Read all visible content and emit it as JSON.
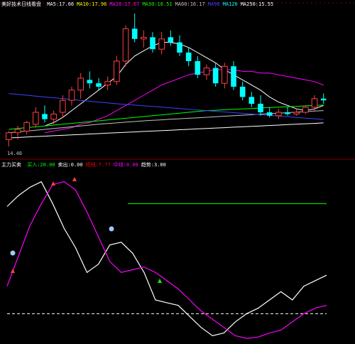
{
  "top_header": {
    "title": "美好技术日线看盘",
    "items": [
      {
        "label": "MA5",
        "value": "17.66",
        "color": "#ffffff"
      },
      {
        "label": "MA10",
        "value": "17.96",
        "color": "#ffff00"
      },
      {
        "label": "MA20",
        "value": "17.67",
        "color": "#ff00ff"
      },
      {
        "label": "MA30",
        "value": "16.51",
        "color": "#00ff00"
      },
      {
        "label": "MA60",
        "value": "16.17",
        "color": "#c0c0c0"
      },
      {
        "label": "MA90",
        "value": "",
        "color": "#4040ff"
      },
      {
        "label": "MA120",
        "value": "",
        "color": "#00ffff"
      },
      {
        "label": "MA250",
        "value": "15.55",
        "color": "#ffffff"
      }
    ]
  },
  "bottom_header": {
    "title": "主力买卖",
    "items": [
      {
        "label": "买入",
        "value": "20.00",
        "color": "#00ff00"
      },
      {
        "label": "卖出",
        "value": "0.00",
        "color": "#ffffff"
      },
      {
        "label": "短线",
        "value": "7.77",
        "color": "#ff0000"
      },
      {
        "label": "中线",
        "value": "0.00",
        "color": "#ff00ff"
      },
      {
        "label": "趋势",
        "value": "3.00",
        "color": "#ffffff"
      }
    ]
  },
  "low_price_label": "14.46",
  "colors": {
    "up": "#ff4040",
    "down": "#00ffff",
    "grid": "#800000"
  },
  "chart_data": [
    {
      "type": "candlestick",
      "ylim": [
        14.0,
        22.5
      ],
      "candles": [
        {
          "o": 14.9,
          "h": 15.4,
          "l": 14.5,
          "c": 15.3
        },
        {
          "o": 15.3,
          "h": 15.7,
          "l": 14.9,
          "c": 15.5
        },
        {
          "o": 15.4,
          "h": 16.0,
          "l": 15.2,
          "c": 15.9
        },
        {
          "o": 15.8,
          "h": 16.8,
          "l": 15.6,
          "c": 16.5
        },
        {
          "o": 16.4,
          "h": 16.9,
          "l": 15.9,
          "c": 16.1
        },
        {
          "o": 16.1,
          "h": 16.6,
          "l": 15.8,
          "c": 16.4
        },
        {
          "o": 16.5,
          "h": 17.5,
          "l": 16.2,
          "c": 17.2
        },
        {
          "o": 17.2,
          "h": 18.0,
          "l": 16.9,
          "c": 17.8
        },
        {
          "o": 17.8,
          "h": 18.8,
          "l": 17.3,
          "c": 18.5
        },
        {
          "o": 18.4,
          "h": 18.9,
          "l": 17.9,
          "c": 18.2
        },
        {
          "o": 18.2,
          "h": 18.5,
          "l": 17.8,
          "c": 18.0
        },
        {
          "o": 18.1,
          "h": 18.6,
          "l": 17.8,
          "c": 18.3
        },
        {
          "o": 18.3,
          "h": 19.8,
          "l": 18.1,
          "c": 19.5
        },
        {
          "o": 19.5,
          "h": 21.6,
          "l": 19.2,
          "c": 21.4
        },
        {
          "o": 21.4,
          "h": 22.3,
          "l": 20.6,
          "c": 20.8
        },
        {
          "o": 20.8,
          "h": 21.3,
          "l": 20.3,
          "c": 20.9
        },
        {
          "o": 20.9,
          "h": 21.2,
          "l": 20.0,
          "c": 20.2
        },
        {
          "o": 20.2,
          "h": 21.2,
          "l": 19.9,
          "c": 20.8
        },
        {
          "o": 20.9,
          "h": 21.3,
          "l": 20.4,
          "c": 20.6
        },
        {
          "o": 20.6,
          "h": 21.0,
          "l": 19.8,
          "c": 20.0
        },
        {
          "o": 20.0,
          "h": 20.3,
          "l": 19.2,
          "c": 19.5
        },
        {
          "o": 19.5,
          "h": 19.8,
          "l": 18.5,
          "c": 18.7
        },
        {
          "o": 18.7,
          "h": 19.3,
          "l": 18.4,
          "c": 19.1
        },
        {
          "o": 19.1,
          "h": 19.4,
          "l": 18.0,
          "c": 18.2
        },
        {
          "o": 18.2,
          "h": 19.4,
          "l": 17.9,
          "c": 19.2
        },
        {
          "o": 19.2,
          "h": 19.5,
          "l": 17.8,
          "c": 18.0
        },
        {
          "o": 18.0,
          "h": 18.3,
          "l": 17.2,
          "c": 17.4
        },
        {
          "o": 17.4,
          "h": 17.7,
          "l": 16.8,
          "c": 17.0
        },
        {
          "o": 17.0,
          "h": 17.5,
          "l": 16.3,
          "c": 16.5
        },
        {
          "o": 16.5,
          "h": 16.8,
          "l": 16.2,
          "c": 16.3
        },
        {
          "o": 16.3,
          "h": 16.7,
          "l": 16.1,
          "c": 16.5
        },
        {
          "o": 16.5,
          "h": 16.8,
          "l": 16.3,
          "c": 16.4
        },
        {
          "o": 16.4,
          "h": 16.7,
          "l": 16.3,
          "c": 16.5
        },
        {
          "o": 16.5,
          "h": 16.9,
          "l": 16.4,
          "c": 16.8
        },
        {
          "o": 16.8,
          "h": 17.5,
          "l": 16.6,
          "c": 17.3
        },
        {
          "o": 17.3,
          "h": 17.6,
          "l": 17.0,
          "c": 17.2
        }
      ],
      "moving_averages": [
        {
          "name": "MA5",
          "color": "#ffffff",
          "values": [
            null,
            null,
            null,
            null,
            15.7,
            15.9,
            16.2,
            16.6,
            17.0,
            17.4,
            17.8,
            18.2,
            18.6,
            19.3,
            19.8,
            20.1,
            20.4,
            20.6,
            20.6,
            20.5,
            20.3,
            20.0,
            19.7,
            19.4,
            19.0,
            18.7,
            18.4,
            18.1,
            17.8,
            17.4,
            17.1,
            16.9,
            16.7,
            16.6,
            16.7,
            16.9
          ]
        },
        {
          "name": "MA20",
          "color": "#ff00ff",
          "values": [
            null,
            null,
            null,
            null,
            15.3,
            15.4,
            15.5,
            15.6,
            15.8,
            15.9,
            16.1,
            16.3,
            16.6,
            16.9,
            17.2,
            17.5,
            17.8,
            18.1,
            18.3,
            18.5,
            18.7,
            18.8,
            18.9,
            19.0,
            19.0,
            19.0,
            18.9,
            18.9,
            18.8,
            18.8,
            18.7,
            18.6,
            18.5,
            18.4,
            18.3,
            18.1
          ]
        },
        {
          "name": "MA30",
          "color": "#00ff00",
          "values": [
            15.5,
            15.55,
            15.6,
            15.65,
            15.7,
            15.75,
            15.8,
            15.85,
            15.9,
            15.95,
            16.0,
            16.05,
            16.1,
            16.15,
            16.2,
            16.25,
            16.3,
            16.35,
            16.4,
            16.45,
            16.5,
            16.55,
            16.6,
            16.62,
            16.65,
            16.68,
            16.7,
            16.72,
            16.75,
            16.78,
            16.8,
            16.82,
            16.85,
            16.88,
            16.9,
            16.92
          ]
        },
        {
          "name": "MA60",
          "color": "#c0c0c0",
          "values": [
            15.3,
            15.35,
            15.4,
            15.45,
            15.5,
            15.55,
            15.6,
            15.65,
            15.7,
            15.75,
            15.8,
            15.84,
            15.88,
            15.92,
            15.96,
            16.0,
            16.03,
            16.06,
            16.09,
            16.12,
            16.15,
            16.18,
            16.21,
            16.24,
            16.27,
            16.3,
            16.33,
            16.36,
            16.39,
            16.42,
            16.45,
            16.48,
            16.51,
            16.54,
            16.57,
            16.6
          ]
        },
        {
          "name": "MA90",
          "color": "#4040ff",
          "values": [
            17.6,
            17.55,
            17.5,
            17.45,
            17.4,
            17.35,
            17.3,
            17.25,
            17.2,
            17.15,
            17.1,
            17.05,
            17.0,
            16.96,
            16.92,
            16.88,
            16.84,
            16.8,
            16.76,
            16.72,
            16.68,
            16.64,
            16.6,
            16.56,
            16.52,
            16.48,
            16.44,
            16.4,
            16.36,
            16.32,
            16.28,
            16.24,
            16.2,
            16.16,
            16.12,
            16.08
          ]
        },
        {
          "name": "MA250",
          "color": "#ffffff",
          "values": [
            15.0,
            15.02,
            15.05,
            15.08,
            15.1,
            15.13,
            15.15,
            15.18,
            15.2,
            15.23,
            15.25,
            15.28,
            15.3,
            15.33,
            15.35,
            15.38,
            15.4,
            15.43,
            15.45,
            15.48,
            15.5,
            15.53,
            15.55,
            15.58,
            15.6,
            15.63,
            15.65,
            15.68,
            15.7,
            15.73,
            15.75,
            15.78,
            15.8,
            15.83,
            15.85,
            15.88
          ]
        }
      ]
    },
    {
      "type": "line",
      "ylim": [
        -20,
        100
      ],
      "series": [
        {
          "name": "短线",
          "color": "#ffffff",
          "values": [
            78,
            86,
            92,
            96,
            80,
            62,
            48,
            30,
            36,
            50,
            52,
            44,
            30,
            10,
            8,
            6,
            -2,
            -10,
            -16,
            -14,
            -6,
            0,
            4,
            10,
            16,
            10,
            20,
            24,
            28
          ]
        },
        {
          "name": "中线",
          "color": "#ff00ff",
          "values": [
            20,
            42,
            64,
            80,
            94,
            96,
            90,
            74,
            56,
            38,
            30,
            32,
            34,
            30,
            24,
            18,
            10,
            2,
            -4,
            -10,
            -16,
            -18,
            -17,
            -14,
            -12,
            -6,
            0,
            4,
            6
          ]
        }
      ],
      "level_line": {
        "value": 80,
        "color": "#00ff00"
      },
      "zero_line": {
        "value": 0,
        "color": "#ffffff"
      }
    }
  ]
}
